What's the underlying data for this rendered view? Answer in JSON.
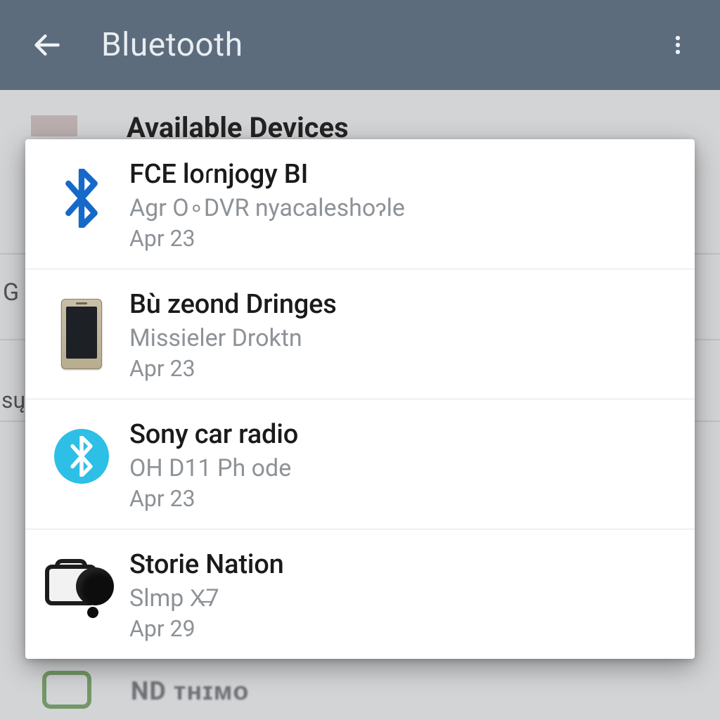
{
  "appbar": {
    "title": "Bluetooth"
  },
  "background": {
    "section_header": "Available Devices",
    "partial_g": "G",
    "partial_su": "sų",
    "bottom_smudge": "ND  ᴛʜɪᴍᴏ"
  },
  "devices": [
    {
      "icon": "bluetooth-glyph",
      "name": "FCE loɾnjogy BI",
      "sub": "Agr O∘DVR nyacaleshoɂle",
      "date": "Apr 23"
    },
    {
      "icon": "phone",
      "name": "Bù zeond Dringes",
      "sub": "Missieler Droktn",
      "date": "Apr 23"
    },
    {
      "icon": "bluetooth-circle",
      "name": "Sony car radio",
      "sub": "OH D11 Ph ode",
      "date": "Apr 23"
    },
    {
      "icon": "camera",
      "name": "Storie Nation",
      "sub": "Slmp X̶7",
      "date": "Apr 29"
    }
  ],
  "colors": {
    "appbar": "#5d6c7c",
    "bluetooth_glyph": "#1669c9",
    "bluetooth_circle": "#2dbfe6"
  }
}
